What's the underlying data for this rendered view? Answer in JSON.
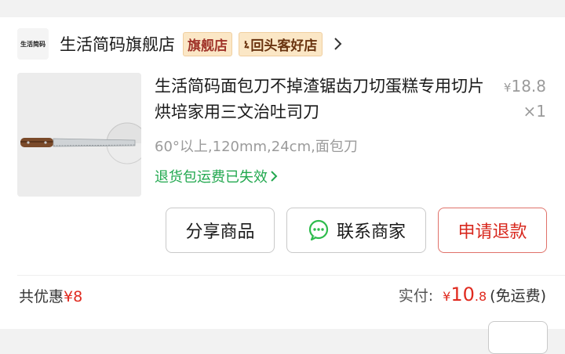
{
  "store": {
    "logo_text": "生活简码",
    "name": "生活简码旗舰店",
    "badge_flagship": "旗舰店",
    "badge_repeat": "回头客好店",
    "badge_repeat_bracket": "ኒ"
  },
  "product": {
    "title": "生活简码面包刀不掉渣锯齿刀切蛋糕专用切片烘培家用三文治吐司刀",
    "price_symbol": "¥",
    "price_value": "18.8",
    "quantity": "×1",
    "spec": "60°以上,120mm,24cm,面包刀",
    "refund_note": "退货包运费已失效"
  },
  "buttons": {
    "share": "分享商品",
    "contact": "联系商家",
    "refund": "申请退款"
  },
  "summary": {
    "discount_label": "共优惠",
    "discount_amount": "¥8",
    "paid_label": "实付:",
    "paid_symbol": "¥",
    "paid_int": "10",
    "paid_dec": ".8",
    "shipping_note": "(免运费)"
  },
  "colors": {
    "accent_red": "#e02a1f",
    "refund_green": "#22a84f",
    "badge_bg": "#fbe7c6"
  },
  "icons": {
    "store_chevron": "chevron-right-icon",
    "refund_chevron": "chevron-right-icon",
    "chat": "wechat-chat-icon"
  }
}
